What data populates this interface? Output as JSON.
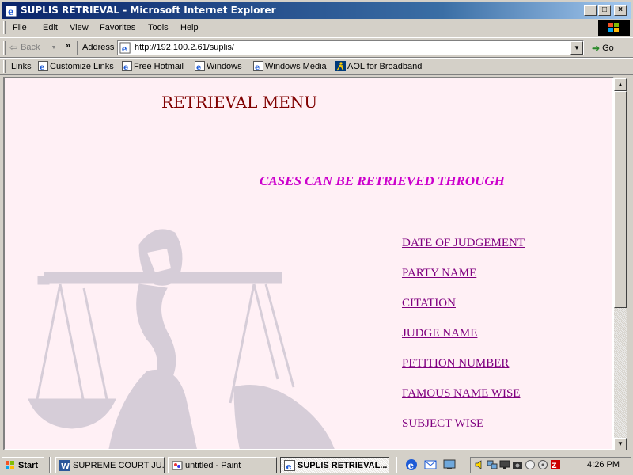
{
  "window": {
    "title": "SUPLIS RETRIEVAL - Microsoft Internet Explorer"
  },
  "menubar": {
    "items": [
      "File",
      "Edit",
      "View",
      "Favorites",
      "Tools",
      "Help"
    ]
  },
  "toolbar": {
    "back_label": "Back",
    "address_label": "Address",
    "url": "http://192.100.2.61/suplis/",
    "go_label": "Go"
  },
  "linksbar": {
    "label": "Links",
    "links": [
      "Customize Links",
      "Free Hotmail",
      "Windows",
      "Windows Media",
      "AOL for Broadband"
    ]
  },
  "page": {
    "heading": "RETRIEVAL MENU",
    "subheading": "CASES CAN BE RETRIEVED THROUGH",
    "menu_links": [
      "DATE OF JUDGEMENT",
      "PARTY NAME",
      "CITATION",
      "JUDGE NAME",
      "PETITION NUMBER",
      "FAMOUS NAME WISE",
      "SUBJECT WISE"
    ]
  },
  "taskbar": {
    "start_label": "Start",
    "tasks": [
      "SUPREME COURT JU...",
      "untitled - Paint",
      "SUPLIS RETRIEVAL..."
    ],
    "clock": "4:26 PM"
  },
  "colors": {
    "heading": "#800000",
    "subheading": "#cc00cc",
    "link": "#800080",
    "page_bg": "#fff0f5",
    "watermark": "#d6cdd8"
  }
}
